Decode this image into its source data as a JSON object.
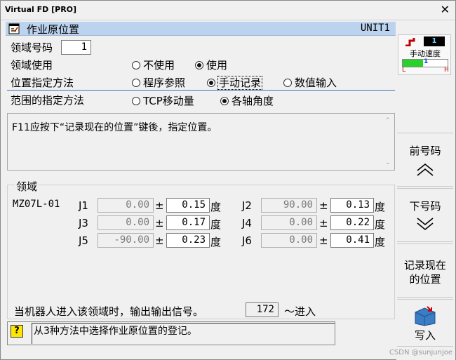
{
  "window": {
    "title": "Virtual FD [PRO]",
    "close": "✕"
  },
  "header": {
    "title": "作业原位置",
    "unit": "UNIT1"
  },
  "form": {
    "area_number_label": "领域号码",
    "area_number_value": "1",
    "area_use_label": "领域使用",
    "area_use_options": [
      "不使用",
      "使用"
    ],
    "area_use_selected": "使用",
    "position_method_label": "位置指定方法",
    "position_method_options": [
      "程序参照",
      "手动记录",
      "数值输入"
    ],
    "position_method_selected": "手动记录",
    "range_method_label": "范围的指定方法",
    "range_method_options": [
      "TCP移动量",
      "各轴角度"
    ],
    "range_method_selected": "各轴角度"
  },
  "message": "F11应按下“记录现在的位置”键後，指定位置。",
  "area_group": {
    "label": "领域",
    "robot": "MZ07L-01",
    "pm": "±",
    "unit": "度",
    "joints": [
      {
        "name": "J1",
        "value": "0.00",
        "tolerance": "0.15"
      },
      {
        "name": "J2",
        "value": "90.00",
        "tolerance": "0.13"
      },
      {
        "name": "J3",
        "value": "0.00",
        "tolerance": "0.17"
      },
      {
        "name": "J4",
        "value": "0.00",
        "tolerance": "0.22"
      },
      {
        "name": "J5",
        "value": "-90.00",
        "tolerance": "0.23"
      },
      {
        "name": "J6",
        "value": "0.00",
        "tolerance": "0.41"
      }
    ],
    "output_text": "当机器人进入该领域时，输出输出信号。",
    "output_signal": "172",
    "output_suffix": "～进入"
  },
  "status": {
    "q": "?",
    "text": "从3种方法中选择作业原位置的登记。"
  },
  "speed_panel": {
    "value": "1",
    "label": "手动速度",
    "bar_value": "1",
    "low": "L",
    "high": "H",
    "bar_fraction": 0.45
  },
  "right_buttons": {
    "prev": {
      "label": "前号码",
      "icon": "chevron-up-icon"
    },
    "next": {
      "label": "下号码",
      "icon": "chevron-down-icon"
    },
    "record": {
      "line1": "记录现在",
      "line2": "的位置"
    },
    "write": {
      "label": "写入",
      "icon": "folder-write-icon"
    }
  },
  "watermark": "CSDN @sunjunjoe",
  "colors": {
    "header_bg": "#bcd3ef",
    "divider": "#3c6fb5",
    "status_icon": "#ffe600",
    "speed_bar": "#2bd12b"
  }
}
